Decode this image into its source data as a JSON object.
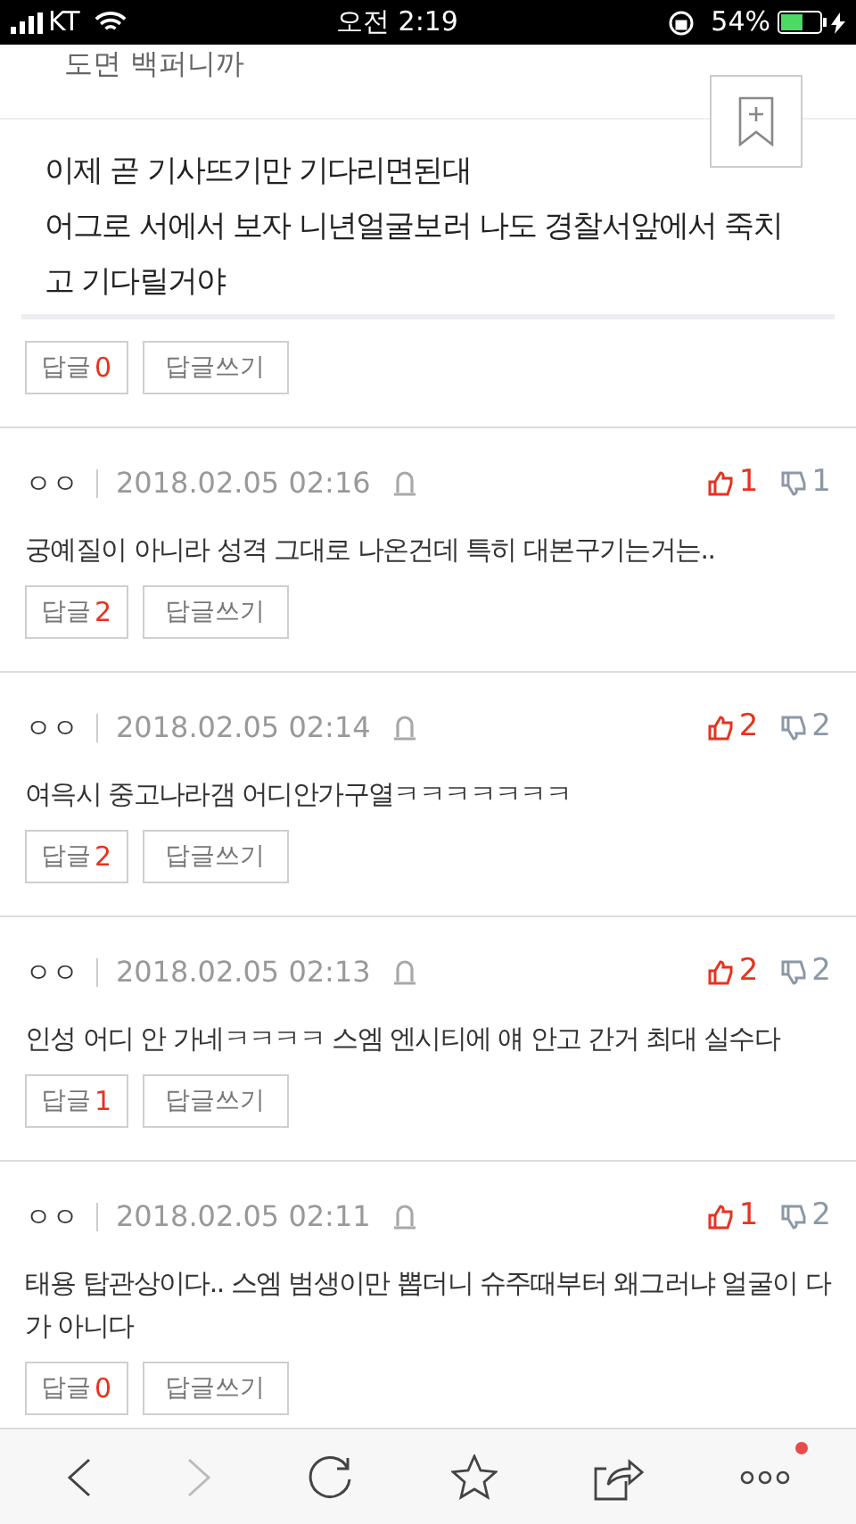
{
  "status_bar": {
    "carrier": "KT",
    "time": "오전 2:19",
    "battery": "54%"
  },
  "top_fragment": "도면 백퍼니까",
  "quote": {
    "paragraphs": [
      "이제 곧 기사뜨기만 기다리면된대",
      "어그로 서에서 보자 니년얼굴보러 나도 경찰서앞에서 죽치고 기다릴거야"
    ]
  },
  "first_actions": {
    "reply_label": "답글",
    "reply_count": "0",
    "write_label": "답글쓰기"
  },
  "comments": [
    {
      "author": "ㅇㅇ",
      "date": "2018.02.05 02:16",
      "likes": "1",
      "dislikes": "1",
      "text": "궁예질이 아니라 성격 그대로 나온건데 특히 대본구기는거는..",
      "reply_label": "답글",
      "reply_count": "2",
      "write_label": "답글쓰기"
    },
    {
      "author": "ㅇㅇ",
      "date": "2018.02.05 02:14",
      "likes": "2",
      "dislikes": "2",
      "text": "여윽시 중고나라갬 어디안가구열ㅋㅋㅋㅋㅋㅋㅋ",
      "reply_label": "답글",
      "reply_count": "2",
      "write_label": "답글쓰기"
    },
    {
      "author": "ㅇㅇ",
      "date": "2018.02.05 02:13",
      "likes": "2",
      "dislikes": "2",
      "text": "인성 어디 안 가네ㅋㅋㅋㅋ 스엠 엔시티에 얘 안고 간거 최대 실수다",
      "reply_label": "답글",
      "reply_count": "1",
      "write_label": "답글쓰기"
    },
    {
      "author": "ㅇㅇ",
      "date": "2018.02.05 02:11",
      "likes": "1",
      "dislikes": "2",
      "text": "태용 탑관상이다.. 스엠 범생이만 뽑더니 슈주때부터 왜그러냐 얼굴이 다가 아니다",
      "reply_label": "답글",
      "reply_count": "0",
      "write_label": "답글쓰기"
    }
  ],
  "toolbar": {
    "back_disabled": false,
    "forward_disabled": true,
    "more_badge": true
  }
}
